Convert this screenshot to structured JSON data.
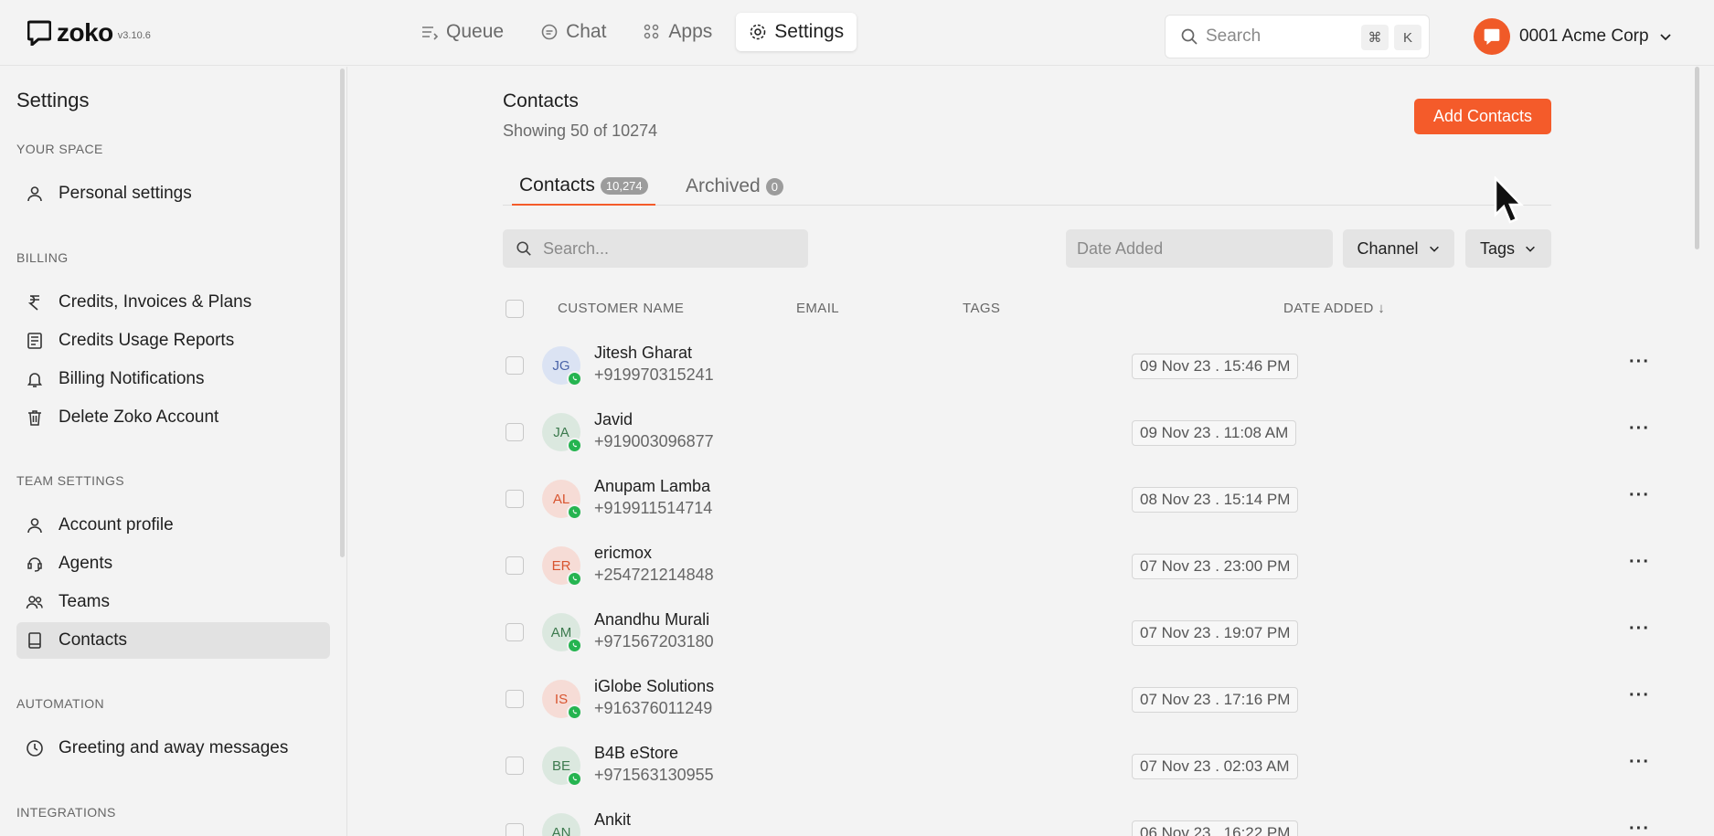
{
  "app": {
    "logo_text": "zoko",
    "version": "v3.10.6"
  },
  "nav": [
    {
      "label": "Queue",
      "icon": "queue-icon",
      "active": false
    },
    {
      "label": "Chat",
      "icon": "chat-icon",
      "active": false
    },
    {
      "label": "Apps",
      "icon": "apps-icon",
      "active": false
    },
    {
      "label": "Settings",
      "icon": "gear-icon",
      "active": true
    }
  ],
  "top_search": {
    "placeholder": "Search",
    "shortcut_key1": "⌘",
    "shortcut_key2": "K"
  },
  "account": {
    "name": "0001 Acme Corp"
  },
  "sidebar": {
    "title": "Settings",
    "sections": [
      {
        "label": "YOUR SPACE",
        "items": [
          {
            "label": "Personal settings",
            "icon": "user-icon"
          }
        ]
      },
      {
        "label": "BILLING",
        "items": [
          {
            "label": "Credits, Invoices & Plans",
            "icon": "rupee-icon"
          },
          {
            "label": "Credits Usage Reports",
            "icon": "report-icon"
          },
          {
            "label": "Billing Notifications",
            "icon": "bell-icon"
          },
          {
            "label": "Delete Zoko Account",
            "icon": "trash-icon"
          }
        ]
      },
      {
        "label": "TEAM SETTINGS",
        "items": [
          {
            "label": "Account profile",
            "icon": "user-icon"
          },
          {
            "label": "Agents",
            "icon": "agent-icon"
          },
          {
            "label": "Teams",
            "icon": "teams-icon"
          },
          {
            "label": "Contacts",
            "icon": "book-icon",
            "active": true
          }
        ]
      },
      {
        "label": "AUTOMATION",
        "items": [
          {
            "label": "Greeting and away messages",
            "icon": "clock-icon"
          }
        ]
      },
      {
        "label": "INTEGRATIONS",
        "items": []
      }
    ]
  },
  "main": {
    "title": "Contacts",
    "subtitle": "Showing 50 of 10274",
    "add_button": "Add Contacts",
    "tabs": [
      {
        "label": "Contacts",
        "count": "10,274",
        "active": true
      },
      {
        "label": "Archived",
        "count": "0",
        "active": false
      }
    ],
    "search_placeholder": "Search...",
    "date_placeholder": "Date Added",
    "channel_label": "Channel",
    "tags_label": "Tags",
    "columns": {
      "name": "CUSTOMER NAME",
      "email": "EMAIL",
      "tags": "TAGS",
      "date": "DATE ADDED ↓"
    },
    "rows": [
      {
        "initials": "JG",
        "name": "Jitesh Gharat",
        "phone": "+919970315241",
        "date": "09 Nov 23 . 15:46 PM",
        "bg": "#dbe3f3",
        "fg": "#4a63a8"
      },
      {
        "initials": "JA",
        "name": "Javid",
        "phone": "+919003096877",
        "date": "09 Nov 23 . 11:08 AM",
        "bg": "#dbe8df",
        "fg": "#3c7a4e"
      },
      {
        "initials": "AL",
        "name": "Anupam Lamba",
        "phone": "+919911514714",
        "date": "08 Nov 23 . 15:14 PM",
        "bg": "#f6dcd6",
        "fg": "#d8542f"
      },
      {
        "initials": "ER",
        "name": "ericmox",
        "phone": "+254721214848",
        "date": "07 Nov 23 . 23:00 PM",
        "bg": "#f6dcd6",
        "fg": "#d8542f"
      },
      {
        "initials": "AM",
        "name": "Anandhu Murali",
        "phone": "+971567203180",
        "date": "07 Nov 23 . 19:07 PM",
        "bg": "#dbe8df",
        "fg": "#3c7a4e"
      },
      {
        "initials": "IS",
        "name": "iGlobe Solutions",
        "phone": "+916376011249",
        "date": "07 Nov 23 . 17:16 PM",
        "bg": "#f6dcd6",
        "fg": "#d8542f"
      },
      {
        "initials": "BE",
        "name": "B4B eStore",
        "phone": "+971563130955",
        "date": "07 Nov 23 . 02:03 AM",
        "bg": "#dbe8df",
        "fg": "#3c7a4e"
      },
      {
        "initials": "AN",
        "name": "Ankit",
        "phone": "",
        "date": "06 Nov 23 . 16:22 PM",
        "bg": "#dbe8df",
        "fg": "#3c7a4e"
      }
    ],
    "more_label": "···"
  },
  "colors": {
    "accent": "#f45b2a",
    "whatsapp": "#25b450"
  }
}
